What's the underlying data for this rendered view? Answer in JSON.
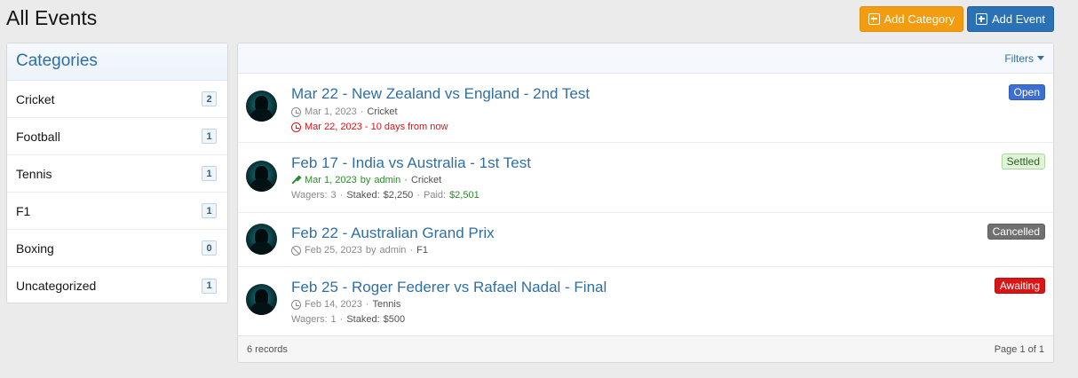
{
  "page": {
    "title": "All Events"
  },
  "toolbar": {
    "add_category_label": "Add Category",
    "add_event_label": "Add Event"
  },
  "sidebar": {
    "header": "Categories",
    "items": [
      {
        "label": "Cricket",
        "count": "2"
      },
      {
        "label": "Football",
        "count": "1"
      },
      {
        "label": "Tennis",
        "count": "1"
      },
      {
        "label": "F1",
        "count": "1"
      },
      {
        "label": "Boxing",
        "count": "0"
      },
      {
        "label": "Uncategorized",
        "count": "1"
      }
    ]
  },
  "main": {
    "filters_label": "Filters",
    "events": [
      {
        "title": "Mar 22 - New Zealand vs England - 2nd Test",
        "status": "Open",
        "date": "Mar 1, 2023",
        "category": "Cricket",
        "alarm_text": "Mar 22, 2023 - 10 days from now"
      },
      {
        "title": "Feb 17 - India vs Australia - 1st Test",
        "status": "Settled",
        "date": "Mar 1, 2023",
        "by": "by",
        "author": "admin",
        "category": "Cricket",
        "wagers_label": "Wagers:",
        "wagers": "3",
        "staked_label": "Staked:",
        "staked": "$2,250",
        "paid_label": "Paid:",
        "paid": "$2,501"
      },
      {
        "title": "Feb 22 - Australian Grand Prix",
        "status": "Cancelled",
        "date": "Feb 25, 2023",
        "by": "by",
        "author": "admin",
        "category": "F1"
      },
      {
        "title": "Feb 25 - Roger Federer vs Rafael Nadal - Final",
        "status": "Awaiting",
        "date": "Feb 14, 2023",
        "category": "Tennis",
        "wagers_label": "Wagers:",
        "wagers": "1",
        "staked_label": "Staked:",
        "staked": "$500"
      }
    ],
    "footer": {
      "records": "6 records",
      "pagination": "Page 1 of 1"
    }
  },
  "colors": {
    "link_blue": "#2f6fa6",
    "add_category_bg": "#f39c12",
    "add_event_bg": "#2a72b5",
    "status_open": "#3d6fd3",
    "status_settled": "#dff5d8",
    "status_cancelled": "#707070",
    "status_awaiting": "#d91515"
  }
}
